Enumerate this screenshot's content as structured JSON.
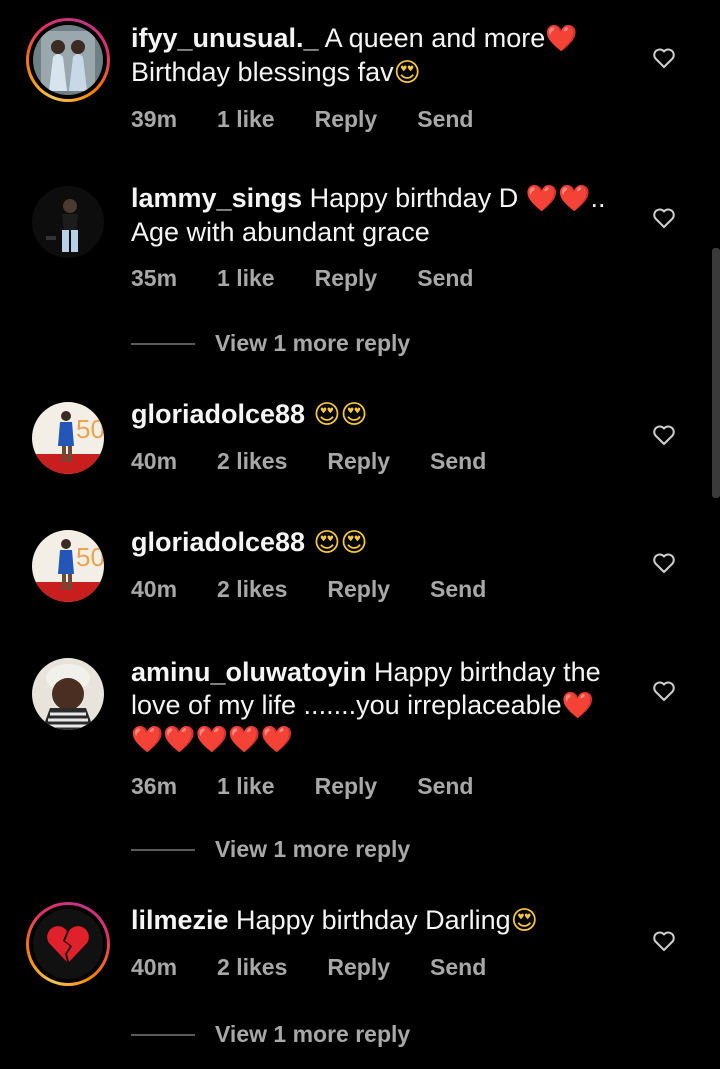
{
  "comments": [
    {
      "username": "ifyy_unusual._",
      "text_line1": " A queen and more",
      "emoji1": "❤️",
      "text_line2": "Birthday blessings fav",
      "emoji2": "😍",
      "time": "39m",
      "likes": "1 like",
      "reply": "Reply",
      "send": "Send"
    },
    {
      "username": "lammy_sings",
      "text_line1": " Happy birthday D ",
      "emoji1": "❤️❤️",
      "text_tail": "..",
      "text_line2": "Age with abundant grace",
      "time": "35m",
      "likes": "1 like",
      "reply": "Reply",
      "send": "Send",
      "view_more": "View 1 more reply"
    },
    {
      "username": "gloriadolce88",
      "emoji1": " 😍😍",
      "time": "40m",
      "likes": "2 likes",
      "reply": "Reply",
      "send": "Send"
    },
    {
      "username": "gloriadolce88",
      "emoji1": " 😍😍",
      "time": "40m",
      "likes": "2 likes",
      "reply": "Reply",
      "send": "Send"
    },
    {
      "username": "aminu_oluwatoyin",
      "text_line1": " Happy birthday the",
      "text_line2": "love of my life .......you irreplaceable",
      "emoji2": "❤️",
      "emoji_line3": "❤️❤️❤️❤️❤️",
      "time": "36m",
      "likes": "1 like",
      "reply": "Reply",
      "send": "Send",
      "view_more": "View 1 more reply"
    },
    {
      "username": "lilmezie",
      "text_line1": " Happy birthday Darling",
      "emoji1": "😍",
      "time": "40m",
      "likes": "2 likes",
      "reply": "Reply",
      "send": "Send",
      "view_more": "View 1 more reply"
    }
  ],
  "icons": {
    "like": "heart-outline-icon",
    "broken_heart": "broken-heart-icon"
  },
  "colors": {
    "background": "#000000",
    "secondary_text": "#a8a8a8",
    "heart_red": "#e0202a"
  }
}
